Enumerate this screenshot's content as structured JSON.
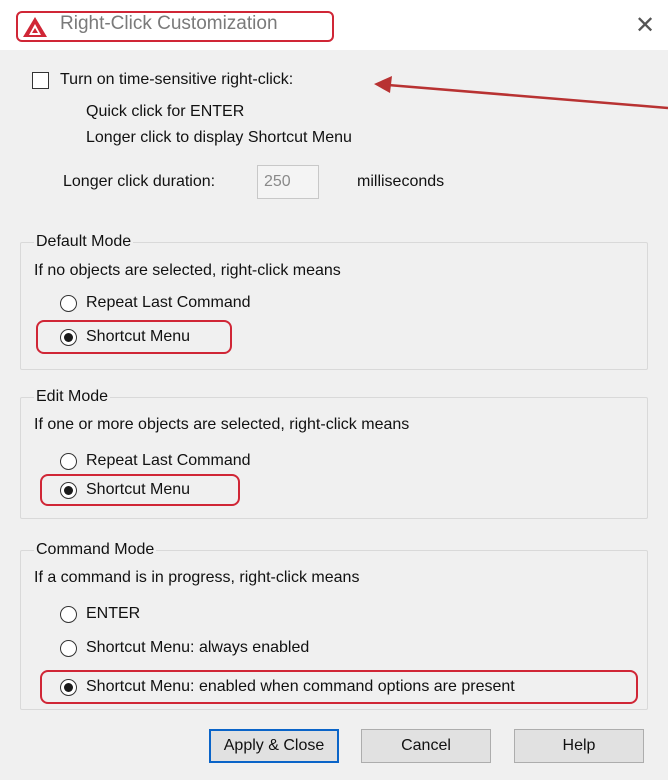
{
  "window": {
    "title": "Right-Click Customization",
    "close_icon": "close-icon",
    "app_icon": "autocad-icon"
  },
  "time_sensitive": {
    "checkbox_label": "Turn on time-sensitive right-click:",
    "checked": false,
    "line1": "Quick click for ENTER",
    "line2": "Longer click to display Shortcut Menu",
    "duration_label": "Longer click duration:",
    "duration_value": "250",
    "duration_unit": "milliseconds"
  },
  "default_mode": {
    "title": "Default Mode",
    "description": "If no objects are selected, right-click means",
    "options": [
      "Repeat Last Command",
      "Shortcut Menu"
    ],
    "selected": "Shortcut Menu"
  },
  "edit_mode": {
    "title": "Edit Mode",
    "description": "If one or more objects are selected, right-click means",
    "options": [
      "Repeat Last Command",
      "Shortcut Menu"
    ],
    "selected": "Shortcut Menu"
  },
  "command_mode": {
    "title": "Command Mode",
    "description": "If a command is in progress, right-click means",
    "options": [
      "ENTER",
      "Shortcut Menu: always enabled",
      "Shortcut Menu: enabled when command options are present"
    ],
    "selected": "Shortcut Menu: enabled when command options are present"
  },
  "buttons": {
    "apply_close": "Apply & Close",
    "cancel": "Cancel",
    "help": "Help"
  },
  "colors": {
    "annotation_red": "#d02636",
    "focus_blue": "#0a64c8"
  }
}
